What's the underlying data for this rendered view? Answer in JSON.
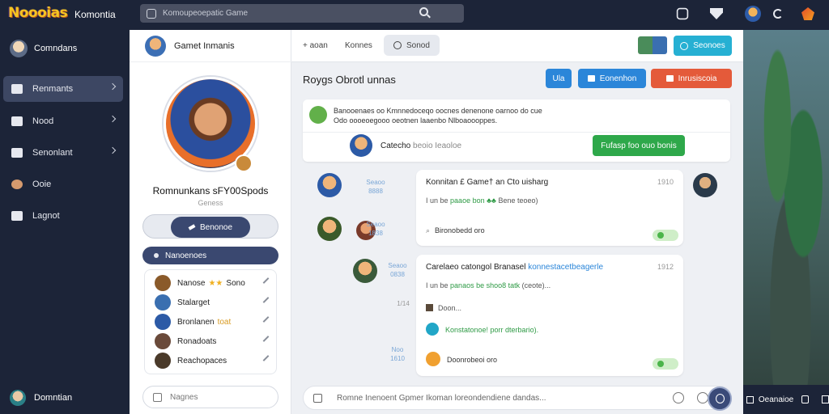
{
  "app": {
    "logo": "Noooias",
    "name": "Komontia"
  },
  "search": {
    "placeholder": "Komoupeoepatic Game"
  },
  "sidebar": {
    "user": "Comndans",
    "items": [
      {
        "label": "Renmants",
        "active": true
      },
      {
        "label": "Nood"
      },
      {
        "label": "Senonlant"
      },
      {
        "label": "Ooie"
      },
      {
        "label": "Lagnot"
      }
    ],
    "footer_user": "Domntian"
  },
  "profile": {
    "header": "Gamet Inmanis",
    "name": "Romnunkans sFY00Spods",
    "subtitle": "Geness",
    "action": "Benonoe",
    "friends_header": "Nanoenoes",
    "friends": [
      {
        "name": "Nanose",
        "tag": "Sono",
        "color": "#8a5a2a"
      },
      {
        "name": "Stalarget",
        "tag": "",
        "color": "#3a6fb0"
      },
      {
        "name": "Bronlanen",
        "tag": "toat",
        "color": "#2c5aa6"
      },
      {
        "name": "Ronadoats",
        "tag": "",
        "color": "#6a4a3a"
      },
      {
        "name": "Reachopaces",
        "tag": "",
        "color": "#4a3a2a"
      }
    ],
    "message_placeholder": "Nagnes"
  },
  "chat": {
    "tabs": [
      {
        "label": "+ aoan"
      },
      {
        "label": "Konnes"
      },
      {
        "label": "Sonod",
        "selected": true
      }
    ],
    "top_button": "Seonoes",
    "room_title": "Roygs Obrotl unnas",
    "room_buttons": [
      "Ula",
      "Eonenhon",
      "Inrusiscoia"
    ],
    "notice": {
      "line1": "Banooenaes oo Kmnnedoceqo oocnes denenone oarnoo do cue",
      "line2": "Odo oooeoegooo oeotnen laaenbo Nlboaoooppes.",
      "user_name": "Catecho",
      "user_handle": "beoio Ieaoloe",
      "button": "Fufasp foo ouo bonis"
    },
    "messages": [
      {
        "meta": "Seaoo\n8888",
        "title": "Konnitan £ Game† an Cto uisharg",
        "time": "1910",
        "line1_prefix": "I un be",
        "line1_highlight": "paaoe bon",
        "line1_suffix": "Bene teoeo)",
        "reply_meta": "Seaoo\n1838",
        "reply_text": "Bironobedd oro"
      },
      {
        "meta": "Seaoo\n0838",
        "title": "Carelaeo catongol Branasel",
        "title_link": "konnestacetbeagerle",
        "time": "1912",
        "line1_prefix": "I un be",
        "line1_highlight": "panaos be shoo8 tatk",
        "line1_suffix": "(ceote)...",
        "line2": "Doon...",
        "side_time": "1/14",
        "mention": "Konstatonoe! porr dterbario).",
        "reply_meta": "Noo\n1610",
        "reply_text": "Doonrobeoi oro"
      }
    ],
    "composer_placeholder": "Romne Inenoent Gpmer Ikoman loreondendiene dandas...",
    "art_label": "Oeanaioe"
  }
}
